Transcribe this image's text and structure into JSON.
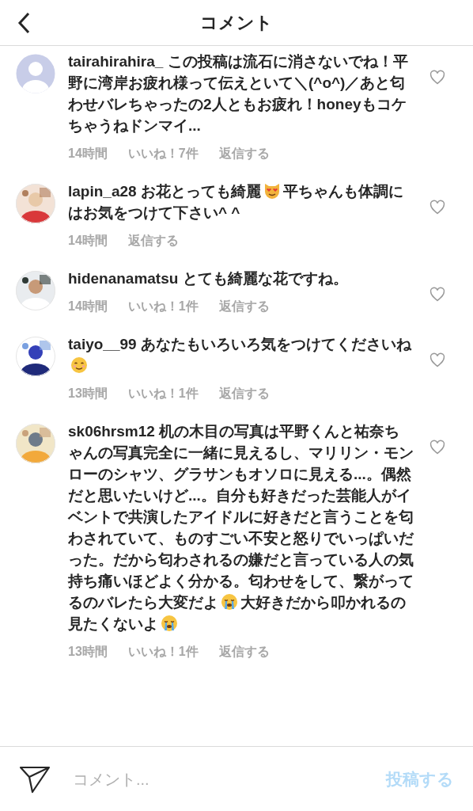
{
  "header": {
    "title": "コメント"
  },
  "comments": [
    {
      "avatar": {
        "kind": "default"
      },
      "username": "tairahirahira_",
      "parts": [
        {
          "kind": "text",
          "text": "この投稿は流石に消さないでね！平野に湾岸お疲れ様って伝えといて＼(^o^)／あと匂わせバレちゃったの2人ともお疲れ！honeyもコケちゃうねドンマイ..."
        }
      ],
      "time": "14時間",
      "likes": "いいね！7件",
      "reply": "返信する"
    },
    {
      "avatar": {
        "kind": "picture"
      },
      "username": "lapin_a28",
      "parts": [
        {
          "kind": "text",
          "text": "お花とっても綺麗"
        },
        {
          "kind": "heart_eyes_cat"
        },
        {
          "kind": "text",
          "text": "平ちゃんも体調にはお気をつけて下さい^ ^"
        }
      ],
      "time": "14時間",
      "reply": "返信する"
    },
    {
      "avatar": {
        "kind": "picture"
      },
      "username": "hidenanamatsu",
      "parts": [
        {
          "kind": "text",
          "text": "とても綺麗な花ですね。"
        }
      ],
      "time": "14時間",
      "likes": "いいね！1件",
      "reply": "返信する"
    },
    {
      "avatar": {
        "kind": "picture"
      },
      "username": "taiyo__99",
      "parts": [
        {
          "kind": "text",
          "text": "あなたもいろいろ気をつけてくださいね"
        },
        {
          "kind": "smiling"
        }
      ],
      "time": "13時間",
      "likes": "いいね！1件",
      "reply": "返信する"
    },
    {
      "avatar": {
        "kind": "picture"
      },
      "username": "sk06hrsm12",
      "parts": [
        {
          "kind": "text",
          "text": "机の木目の写真は平野くんと祐奈ちゃんの写真完全に一緒に見えるし、マリリン・モンローのシャツ、グラサンもオソロに見える...。偶然だと思いたいけど...。自分も好きだった芸能人がイベントで共演したアイドルに好きだと言うことを匂わされていて、ものすごい不安と怒りでいっぱいだった。だから匂わされるの嫌だと言っている人の気持ち痛いほどよく分かる。匂わせをして、繋がってるのバレたら大変だよ"
        },
        {
          "kind": "crying"
        },
        {
          "kind": "text",
          "text": "大好きだから叩かれるの見たくないよ"
        },
        {
          "kind": "crying"
        }
      ],
      "time": "13時間",
      "likes": "いいね！1件",
      "reply": "返信する"
    }
  ],
  "composer": {
    "placeholder": "コメント...",
    "post_button": "投稿する"
  }
}
